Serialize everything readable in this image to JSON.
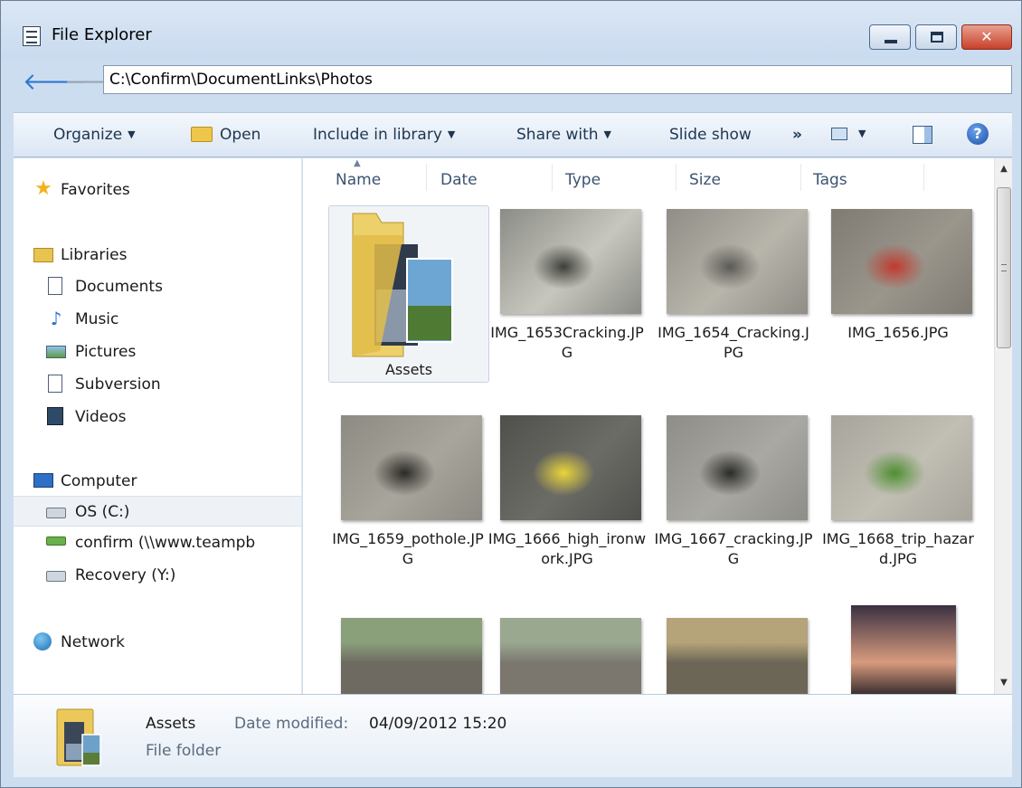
{
  "window": {
    "title": "File Explorer"
  },
  "address": {
    "path": "C:\\Confirm\\DocumentLinks\\Photos"
  },
  "toolbar": {
    "organize": "Organize",
    "open": "Open",
    "include_in_library": "Include in library",
    "share_with": "Share with",
    "slide_show": "Slide show",
    "overflow": "»",
    "help": "?"
  },
  "nav": {
    "favorites": "Favorites",
    "libraries": "Libraries",
    "documents": "Documents",
    "music": "Music",
    "pictures": "Pictures",
    "subversion": "Subversion",
    "videos": "Videos",
    "computer": "Computer",
    "os_c": "OS (C:)",
    "confirm": "confirm (\\\\www.teampb",
    "recovery": "Recovery (Y:)",
    "network": "Network"
  },
  "columns": [
    "Name",
    "Date",
    "Type",
    "Size",
    "Tags"
  ],
  "items": [
    {
      "name": "Assets",
      "kind": "folder"
    },
    {
      "name": "IMG_1653Cracking.JPG",
      "kind": "image",
      "colors": [
        "#8b8c86",
        "#c7c6be",
        "#3e3f3a"
      ]
    },
    {
      "name": "IMG_1654_Cracking.JPG",
      "kind": "image",
      "colors": [
        "#8f8d86",
        "#b8b5ab",
        "#5b5a55"
      ]
    },
    {
      "name": "IMG_1656.JPG",
      "kind": "image",
      "colors": [
        "#7f7b73",
        "#9a968c",
        "#c23a2e"
      ]
    },
    {
      "name": "IMG_1659_pothole.JPG",
      "kind": "image",
      "colors": [
        "#8d8a83",
        "#a8a59c",
        "#2c2a26"
      ]
    },
    {
      "name": "IMG_1666_high_ironwork.JPG",
      "kind": "image",
      "colors": [
        "#4f504c",
        "#6c6c66",
        "#e9d53a"
      ]
    },
    {
      "name": "IMG_1667_cracking.JPG",
      "kind": "image",
      "colors": [
        "#8e8d88",
        "#a9a8a2",
        "#2a2a27"
      ]
    },
    {
      "name": "IMG_1668_trip_hazard.JPG",
      "kind": "image",
      "colors": [
        "#a7a49b",
        "#c1beb4",
        "#4e8f2f"
      ]
    },
    {
      "kind": "image",
      "colors": [
        "#6e6a62",
        "#8aa07a",
        "#d96a1f"
      ]
    },
    {
      "kind": "image",
      "colors": [
        "#7b776f",
        "#9aa890",
        "#d9701e"
      ]
    },
    {
      "kind": "image",
      "colors": [
        "#6c6656",
        "#b5a47a",
        "#8b9b6a"
      ]
    },
    {
      "kind": "image",
      "colors": [
        "#1d1a20",
        "#d89b7e",
        "#3a3042"
      ]
    }
  ],
  "details": {
    "name": "Assets",
    "date_label": "Date modified:",
    "date_value": "04/09/2012 15:20",
    "type": "File folder"
  }
}
